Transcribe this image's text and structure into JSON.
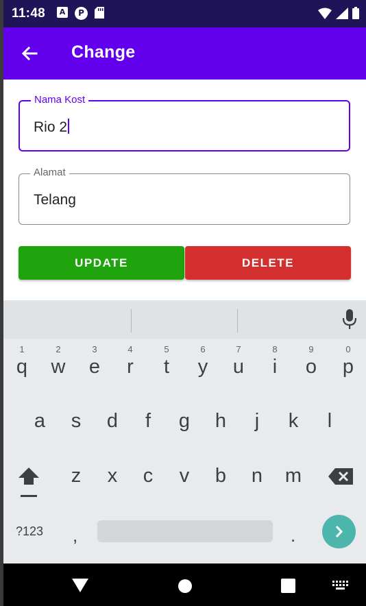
{
  "status_bar": {
    "time": "11:48",
    "left_icons": [
      "a-box-icon",
      "p-circle-icon",
      "sd-card-icon"
    ],
    "right_icons": [
      "wifi-icon",
      "signal-icon",
      "battery-icon"
    ]
  },
  "app_bar": {
    "title": "Change",
    "back_icon": "arrow-left-icon",
    "color": "#6200ee"
  },
  "form": {
    "nama_kost": {
      "label": "Nama Kost",
      "value": "Rio 2",
      "focused": true
    },
    "alamat": {
      "label": "Alamat",
      "value": "Telang",
      "focused": false
    }
  },
  "buttons": {
    "update_label": "UPDATE",
    "update_color": "#1fa40d",
    "delete_label": "DELETE",
    "delete_color": "#d32f2f"
  },
  "keyboard": {
    "row1": [
      {
        "key": "q",
        "hint": "1"
      },
      {
        "key": "w",
        "hint": "2"
      },
      {
        "key": "e",
        "hint": "3"
      },
      {
        "key": "r",
        "hint": "4"
      },
      {
        "key": "t",
        "hint": "5"
      },
      {
        "key": "y",
        "hint": "6"
      },
      {
        "key": "u",
        "hint": "7"
      },
      {
        "key": "i",
        "hint": "8"
      },
      {
        "key": "o",
        "hint": "9"
      },
      {
        "key": "p",
        "hint": "0"
      }
    ],
    "row2": [
      "a",
      "s",
      "d",
      "f",
      "g",
      "h",
      "j",
      "k",
      "l"
    ],
    "row3": [
      "z",
      "x",
      "c",
      "v",
      "b",
      "n",
      "m"
    ],
    "symbols_label": "?123",
    "comma": ",",
    "period": ".",
    "icons": [
      "mic-icon",
      "shift-icon",
      "backspace-icon",
      "enter-arrow-icon"
    ]
  },
  "nav_bar": {
    "icons": [
      "back-triangle-icon",
      "home-circle-icon",
      "recents-square-icon",
      "keyboard-switch-icon"
    ]
  }
}
